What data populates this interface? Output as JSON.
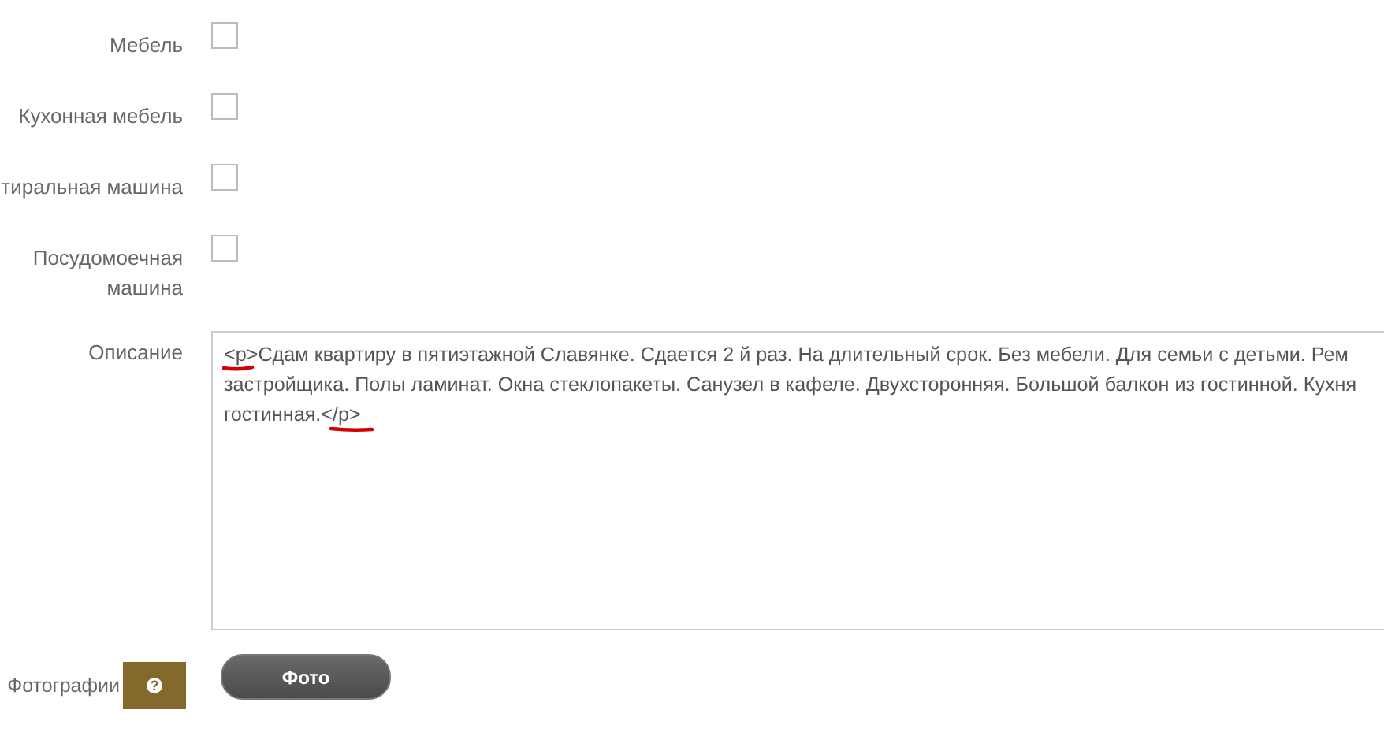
{
  "amenities": [
    {
      "label": "Мебель",
      "checked": false
    },
    {
      "label": "Кухонная мебель",
      "checked": false
    },
    {
      "label": "тиральная машина",
      "checked": false
    },
    {
      "label": "Посудомоечная машина",
      "checked": false
    }
  ],
  "description": {
    "label": "Описание",
    "lines": [
      "<p>Сдам квартиру в пятиэтажной Славянке. Сдается 2 й раз. На длительный срок. Без мебели. Для семьи с детьми. Рем",
      "застройщика. Полы ламинат. Окна стеклопакеты. Санузел в кафеле. Двухсторонняя. Большой балкон из гостинной. Кухня",
      "гостинная.</p>"
    ]
  },
  "photos": {
    "label": "Фотографии",
    "help": "?",
    "button": "Фото"
  }
}
